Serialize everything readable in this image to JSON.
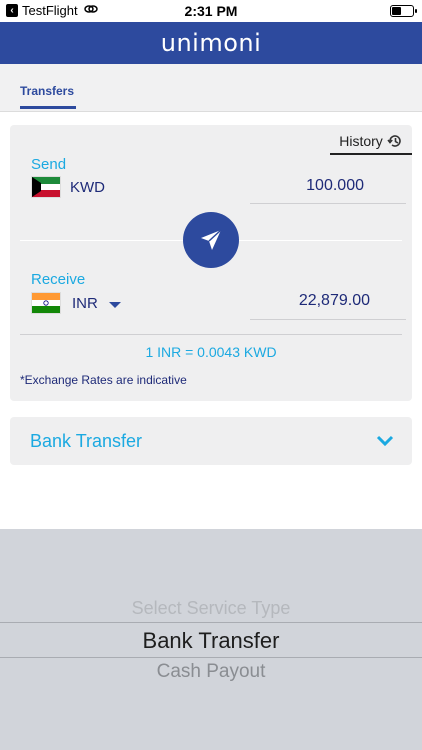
{
  "status_bar": {
    "back_app": "TestFlight",
    "time": "2:31 PM"
  },
  "nav": {
    "brand": "unimoni"
  },
  "tabs": [
    {
      "label": "Transfers",
      "active": true
    }
  ],
  "converter": {
    "history_label": "History",
    "send": {
      "label": "Send",
      "currency": "KWD",
      "amount": "100.000",
      "flag": "kuwait-flag"
    },
    "receive": {
      "label": "Receive",
      "currency": "INR",
      "amount": "22,879.00",
      "flag": "india-flag"
    },
    "rate": "1 INR = 0.0043 KWD",
    "note": "*Exchange Rates are indicative"
  },
  "service": {
    "selected": "Bank Transfer"
  },
  "picker": {
    "options": [
      "Select Service Type",
      "Bank Transfer",
      "Cash Payout"
    ],
    "selected_index": 1
  },
  "colors": {
    "brand_blue": "#2d4a9e",
    "accent_cyan": "#1ba9e1",
    "text_navy": "#1e2a78"
  }
}
